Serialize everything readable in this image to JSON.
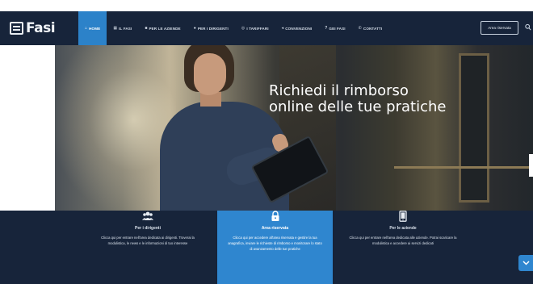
{
  "header": {
    "logo_text": "Fasi",
    "nav": [
      {
        "icon": "home-icon",
        "glyph": "⌂",
        "label": "HOME",
        "active": true
      },
      {
        "icon": "building-icon",
        "glyph": "▦",
        "label": "IL FASI",
        "active": false
      },
      {
        "icon": "briefcase-icon",
        "glyph": "■",
        "label": "PER LE AZIENDE",
        "active": false
      },
      {
        "icon": "users-icon",
        "glyph": "●",
        "label": "PER I DIRIGENTI",
        "active": false
      },
      {
        "icon": "family-icon",
        "glyph": "◎",
        "label": "I TARIFFARI",
        "active": false
      },
      {
        "icon": "handshake-icon",
        "glyph": "◂",
        "label": "CONVENZIONI",
        "active": false
      },
      {
        "icon": "question-icon",
        "glyph": "?",
        "label": "GEI FASI",
        "active": false
      },
      {
        "icon": "phone-icon",
        "glyph": "✆",
        "label": "CONTATTI",
        "active": false
      }
    ],
    "reserved_area_label": "Area riservata"
  },
  "hero": {
    "title_line1": "Richiedi il rimborso",
    "title_line2": "online delle tue pratiche"
  },
  "cards": [
    {
      "icon": "users-icon",
      "title": "Per i dirigenti",
      "desc": "Clicca qui per entrare nell'area dedicata ai dirigenti. Troverai la modulistica, le news e le informazioni di tuo interesse"
    },
    {
      "icon": "lock-icon",
      "title": "Area riservata",
      "desc": "Clicca qui per accedere all'area riservata e gestire la tua anagrafica, inviare le richieste di rimborso e monitorare lo stato di avanzamento delle tue pratiche"
    },
    {
      "icon": "tablet-icon",
      "title": "Per le aziende",
      "desc": "Clicca qui per entrare nell'area dedicata alle aziende. Potrai scaricare la modulistica e accedere ai servizi dedicati"
    }
  ],
  "colors": {
    "navy": "#17243a",
    "accent_blue": "#2f86cf",
    "white": "#ffffff"
  }
}
